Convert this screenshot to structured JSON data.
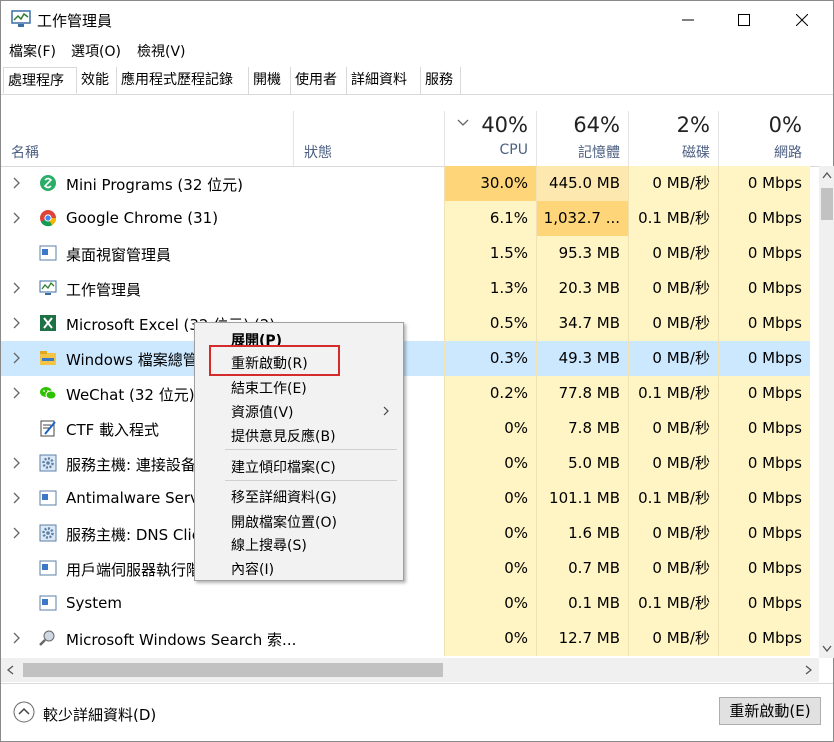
{
  "window": {
    "title": "工作管理員"
  },
  "menu": [
    "檔案(F)",
    "選項(O)",
    "檢視(V)"
  ],
  "tabs": [
    "處理程序",
    "效能",
    "應用程式歷程記錄",
    "開機",
    "使用者",
    "詳細資料",
    "服務"
  ],
  "header": {
    "name": "名稱",
    "status": "狀態",
    "cpu": {
      "pct": "40%",
      "label": "CPU"
    },
    "mem": {
      "pct": "64%",
      "label": "記憶體"
    },
    "disk": {
      "pct": "2%",
      "label": "磁碟"
    },
    "net": {
      "pct": "0%",
      "label": "網路"
    }
  },
  "rows": [
    {
      "name": "Mini Programs (32 位元)",
      "cpu": "30.0%",
      "mem": "445.0 MB",
      "disk": "0 MB/秒",
      "net": "0 Mbps"
    },
    {
      "name": "Google Chrome (31)",
      "cpu": "6.1%",
      "mem": "1,032.7 ...",
      "disk": "0.1 MB/秒",
      "net": "0 Mbps"
    },
    {
      "name": "桌面視窗管理員",
      "cpu": "1.5%",
      "mem": "95.3 MB",
      "disk": "0 MB/秒",
      "net": "0 Mbps"
    },
    {
      "name": "工作管理員",
      "cpu": "1.3%",
      "mem": "20.3 MB",
      "disk": "0 MB/秒",
      "net": "0 Mbps"
    },
    {
      "name": "Microsoft Excel (32 位元) (2)",
      "cpu": "0.5%",
      "mem": "34.7 MB",
      "disk": "0 MB/秒",
      "net": "0 Mbps"
    },
    {
      "name": "Windows 檔案總管",
      "cpu": "0.3%",
      "mem": "49.3 MB",
      "disk": "0 MB/秒",
      "net": "0 Mbps"
    },
    {
      "name": "WeChat (32 位元) (",
      "cpu": "0.2%",
      "mem": "77.8 MB",
      "disk": "0.1 MB/秒",
      "net": "0 Mbps"
    },
    {
      "name": "CTF 載入程式",
      "cpu": "0%",
      "mem": "7.8 MB",
      "disk": "0 MB/秒",
      "net": "0 Mbps"
    },
    {
      "name": "服務主機: 連接設备",
      "cpu": "0%",
      "mem": "5.0 MB",
      "disk": "0 MB/秒",
      "net": "0 Mbps"
    },
    {
      "name": "Antimalware Servi",
      "cpu": "0%",
      "mem": "101.1 MB",
      "disk": "0.1 MB/秒",
      "net": "0 Mbps"
    },
    {
      "name": "服務主機: DNS Clie",
      "cpu": "0%",
      "mem": "1.6 MB",
      "disk": "0 MB/秒",
      "net": "0 Mbps"
    },
    {
      "name": "用戶端伺服器執行階",
      "cpu": "0%",
      "mem": "0.7 MB",
      "disk": "0 MB/秒",
      "net": "0 Mbps"
    },
    {
      "name": "System",
      "cpu": "0%",
      "mem": "0.1 MB",
      "disk": "0.1 MB/秒",
      "net": "0 Mbps"
    },
    {
      "name": "Microsoft Windows Search 索...",
      "cpu": "0%",
      "mem": "12.7 MB",
      "disk": "0 MB/秒",
      "net": "0 Mbps"
    }
  ],
  "context_menu": {
    "expand": "展開(P)",
    "restart": "重新啟動(R)",
    "end_task": "結束工作(E)",
    "resource_values": "資源值(V)",
    "feedback": "提供意見反應(B)",
    "dump": "建立傾印檔案(C)",
    "go_details": "移至詳細資料(G)",
    "open_location": "開啟檔案位置(O)",
    "search_online": "線上搜尋(S)",
    "properties": "內容(I)"
  },
  "footer": {
    "fewer_details": "較少詳細資料(D)",
    "action_button": "重新啟動(E)"
  },
  "colors": {
    "heat_high": "#ffd57a",
    "heat_mid": "#fde9b0",
    "heat_low": "#fff4c4",
    "selected": "#cce8ff",
    "highlight_box": "#d62b2b"
  }
}
